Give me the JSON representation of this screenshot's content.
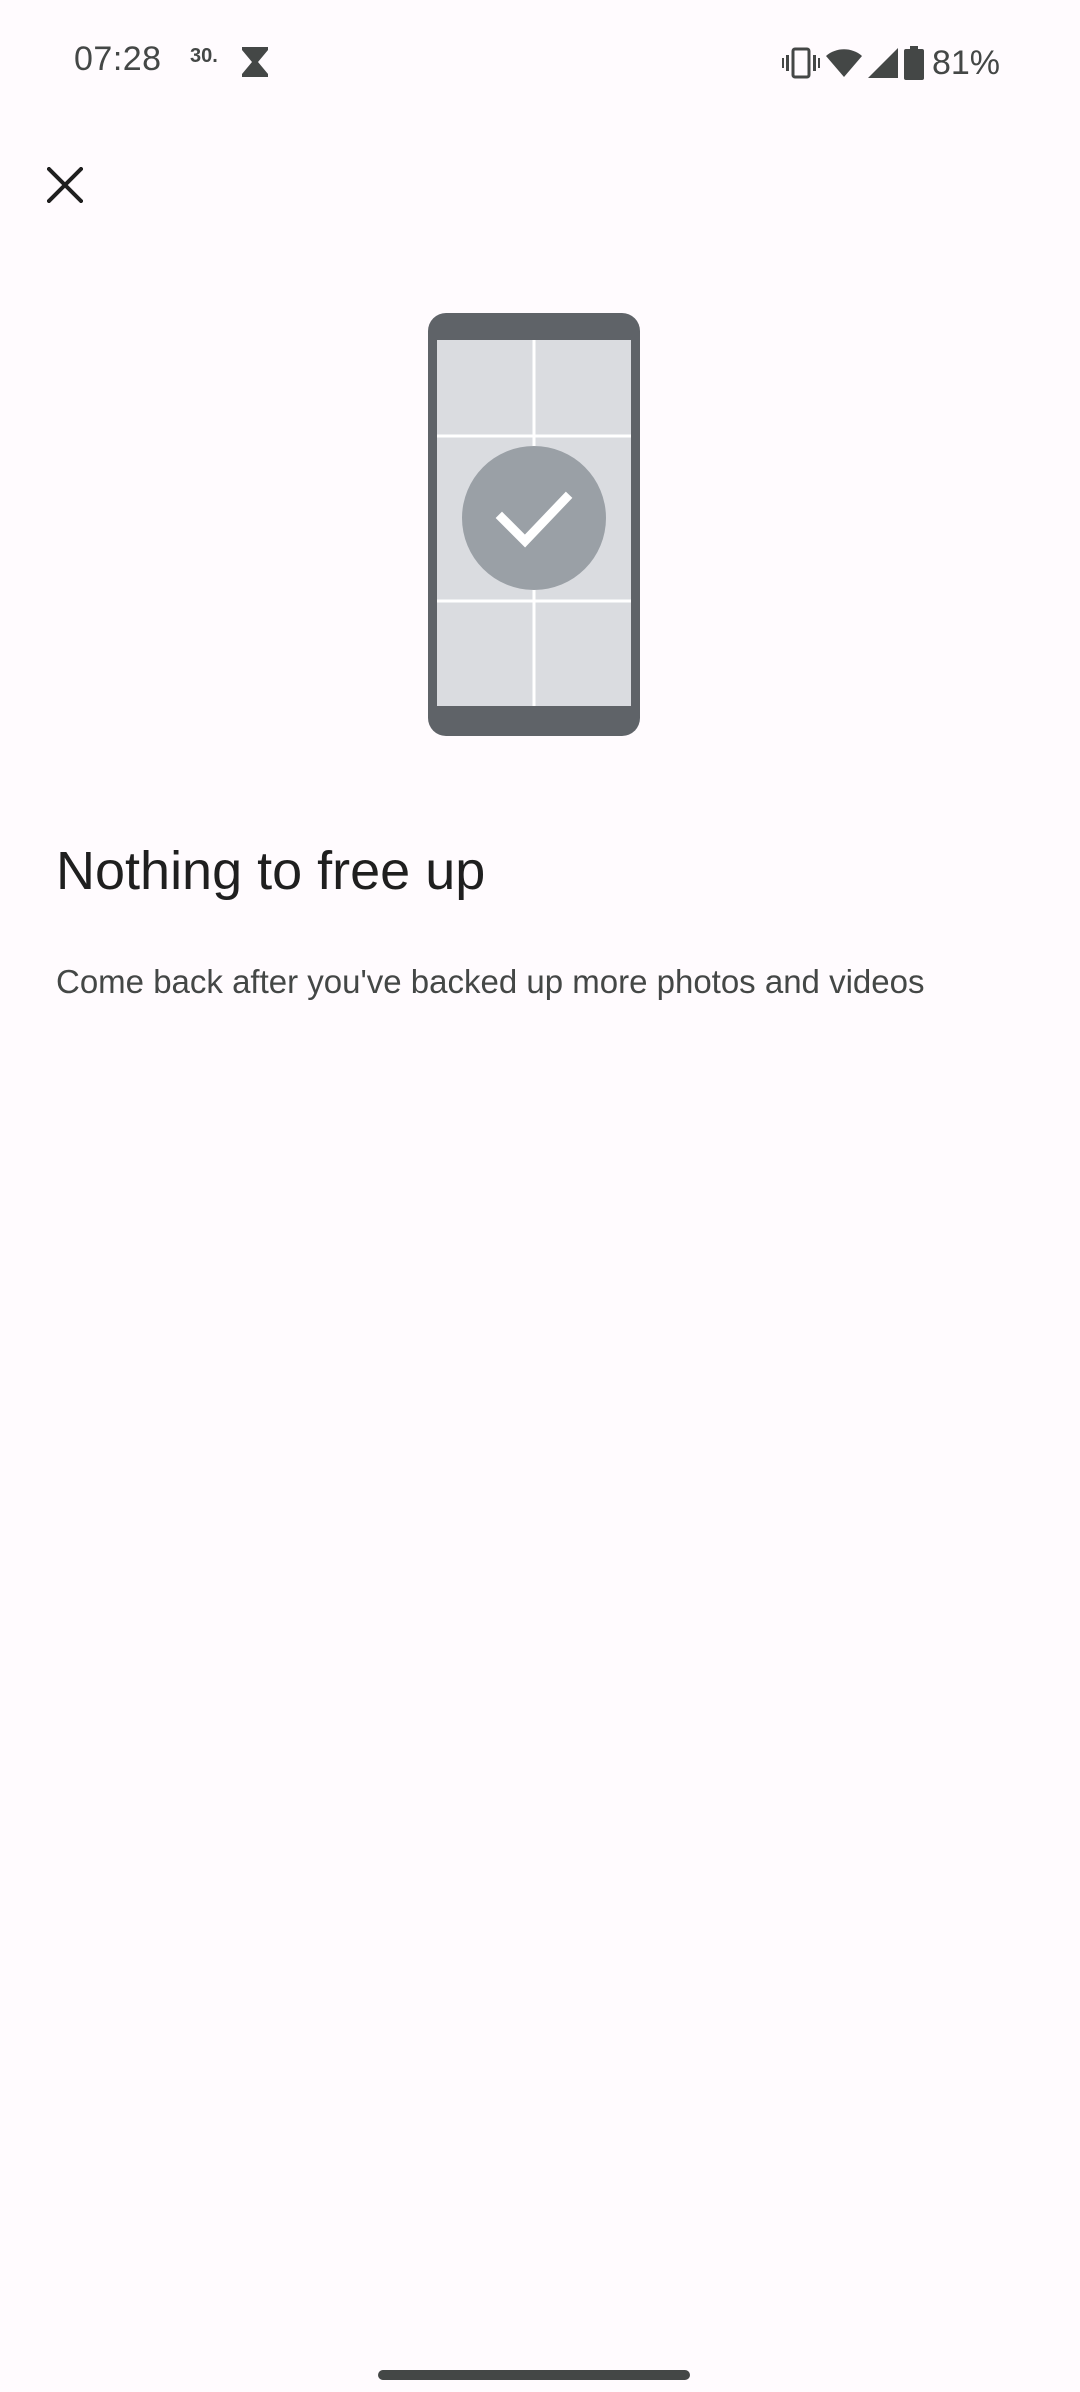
{
  "status_bar": {
    "time": "07:28",
    "notification_date": "30.",
    "battery_percent": "81%",
    "icons": [
      "hourglass-icon",
      "vibrate-icon",
      "wifi-icon",
      "cell-signal-icon",
      "battery-icon"
    ]
  },
  "header": {
    "close_icon": "close-icon"
  },
  "illustration": {
    "icon": "phone-check-illustration",
    "colors": {
      "frame": "#5f6368",
      "screen": "#dadce0",
      "badge": "#9aa0a6",
      "check": "#ffffff"
    }
  },
  "main": {
    "title": "Nothing to free up",
    "message": "Come back after you've backed up more photos and videos"
  },
  "colors": {
    "background": "#fffbfe",
    "text_primary": "#1f1f1f",
    "text_secondary": "#444746"
  }
}
